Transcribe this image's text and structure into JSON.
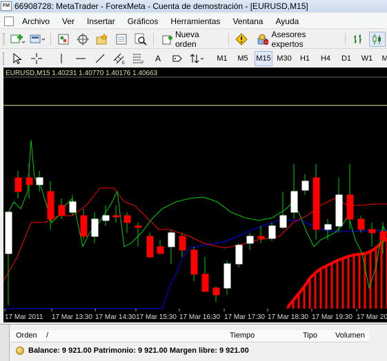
{
  "window": {
    "title": "66908728: MetaTrader - ForexMeta - Cuenta de demostración - [EURUSD,M15]",
    "app_icon_label": "FM"
  },
  "menu": [
    "Archivo",
    "Ver",
    "Insertar",
    "Gráficos",
    "Herramientas",
    "Ventana",
    "Ayuda"
  ],
  "toolbar": {
    "new_order_label": "Nueva orden",
    "experts_label": "Asesores expertos",
    "timeframes": [
      "M1",
      "M5",
      "M15",
      "M30",
      "H1",
      "H4",
      "D1",
      "W1",
      "MN"
    ],
    "active_timeframe": "M15",
    "text_tool_label": "A"
  },
  "chart": {
    "header": "EURUSD,M15  1.40231 1.40770 1.40176 1.40663",
    "time_labels": [
      "17 Mar 2011",
      "17 Mar 13:30",
      "17 Mar 14:30",
      "17 Mar 15:30",
      "17 Mar 16:30",
      "17 Mar 17:30",
      "17 Mar 18:30",
      "17 Mar 19:30",
      "17 Mar 20:"
    ],
    "colors": {
      "bull": "#ffffff",
      "bear": "#ff0000",
      "tenkan": "#ff0000",
      "kijun": "#0000ff",
      "chikou": "#00cc00",
      "hline": "#e8e8a0",
      "cloud": "#ff0000"
    }
  },
  "terminal": {
    "columns": [
      "Orden",
      "/",
      "Tiempo",
      "Tipo",
      "Volumen"
    ],
    "balance_line": "Balance: 9 921.00  Patrimonio: 9 921.00  Margen libre: 9 921.00"
  }
}
